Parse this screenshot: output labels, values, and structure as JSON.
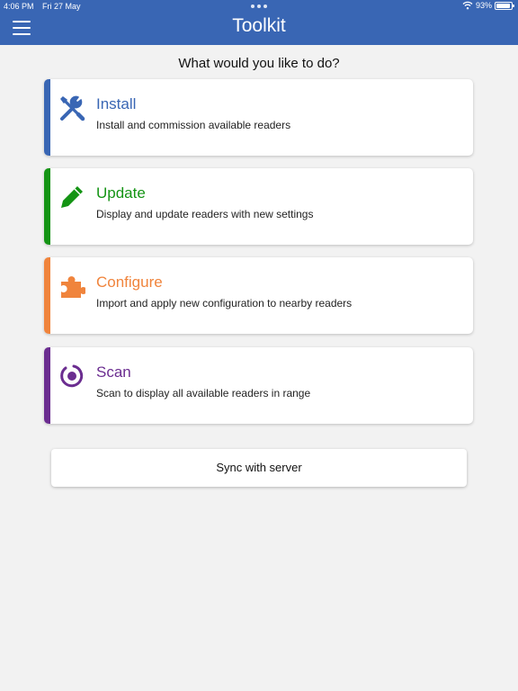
{
  "status_bar": {
    "time": "4:06 PM",
    "date": "Fri 27 May",
    "battery": "93%",
    "battery_level": 0.93
  },
  "header": {
    "title": "Toolkit",
    "menu_icon": "hamburger-menu-icon",
    "background": "#3966b4"
  },
  "prompt": "What would you like to do?",
  "cards": [
    {
      "title": "Install",
      "description": "Install and commission available readers",
      "color": "#3966b4",
      "icon": "tools-icon"
    },
    {
      "title": "Update",
      "description": "Display and update readers with new settings",
      "color": "#149414",
      "icon": "pencil-icon"
    },
    {
      "title": "Configure",
      "description": "Import and apply new configuration to nearby readers",
      "color": "#f0843c",
      "icon": "puzzle-piece-icon"
    },
    {
      "title": "Scan",
      "description": "Scan to display all available readers in range",
      "color": "#6b2d90",
      "icon": "scan-target-icon"
    }
  ],
  "sync_button": {
    "label": "Sync with server"
  }
}
